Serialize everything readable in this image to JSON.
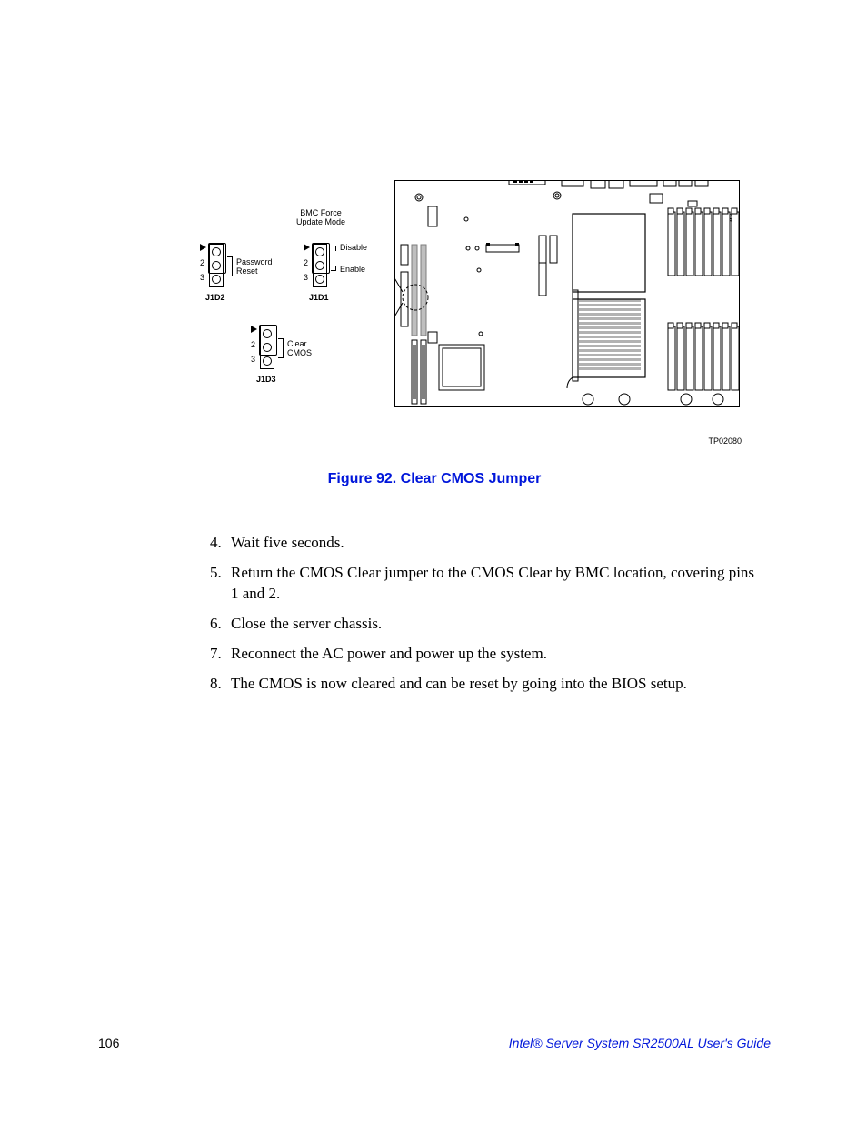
{
  "figure": {
    "caption": "Figure 92. Clear CMOS Jumper",
    "tp": "TP02080",
    "detail": {
      "bmc_title_line1": "BMC Force",
      "bmc_title_line2": "Update Mode",
      "disable": "Disable",
      "enable": "Enable",
      "password_reset_l1": "Password",
      "password_reset_l2": "Reset",
      "clear_cmos_l1": "Clear",
      "clear_cmos_l2": "CMOS",
      "pin2": "2",
      "pin3": "3",
      "j1d1": "J1D1",
      "j1d2": "J1D2",
      "j1d3": "J1D3"
    }
  },
  "steps": [
    {
      "n": 4,
      "text": "Wait five seconds."
    },
    {
      "n": 5,
      "text": "Return the CMOS Clear jumper to the CMOS Clear by BMC location, covering pins 1 and 2."
    },
    {
      "n": 6,
      "text": "Close the server chassis."
    },
    {
      "n": 7,
      "text": "Reconnect the AC power and power up the system."
    },
    {
      "n": 8,
      "text": "The CMOS is now cleared and can be reset by going into the BIOS setup."
    }
  ],
  "footer": {
    "page": "106",
    "title": "Intel® Server System SR2500AL User's Guide"
  }
}
